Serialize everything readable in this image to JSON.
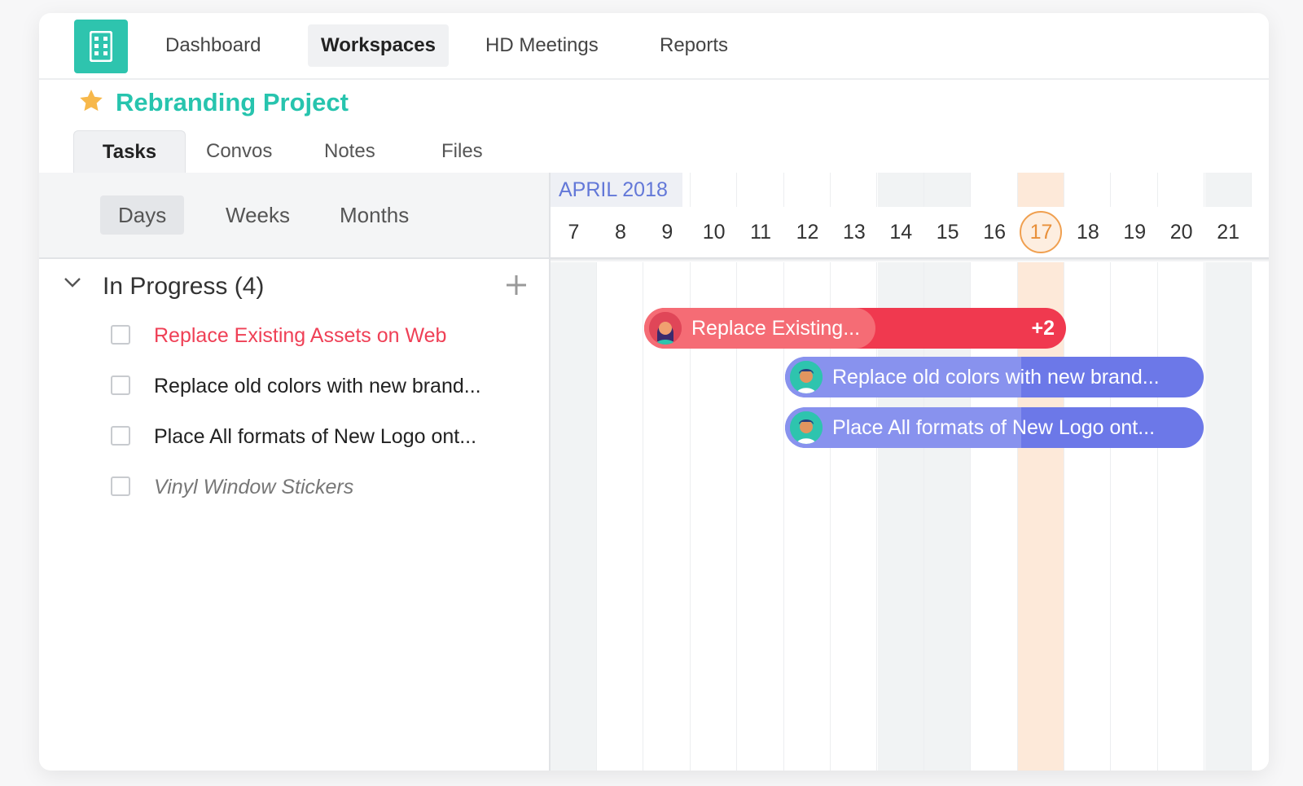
{
  "nav": {
    "items": [
      "Dashboard",
      "Workspaces",
      "HD Meetings",
      "Reports"
    ],
    "active": "Workspaces"
  },
  "project": {
    "title": "Rebranding Project"
  },
  "tabs": [
    "Tasks",
    "Convos",
    "Notes",
    "Files"
  ],
  "view_modes": [
    "Days",
    "Weeks",
    "Months"
  ],
  "group": {
    "title": "In Progress (4)"
  },
  "tasks": [
    {
      "label": "Replace Existing Assets on Web"
    },
    {
      "label": "Replace old colors with new brand..."
    },
    {
      "label": "Place All formats of New Logo ont..."
    },
    {
      "label": "Vinyl Window Stickers"
    }
  ],
  "timeline": {
    "month": "APRIL 2018",
    "days": [
      "7",
      "8",
      "9",
      "10",
      "11",
      "12",
      "13",
      "14",
      "15",
      "16",
      "17",
      "18",
      "19",
      "20",
      "21"
    ],
    "today": "17",
    "bars": [
      {
        "label": "Replace Existing...",
        "extra": "+2",
        "color": "#f0394f"
      },
      {
        "label": "Replace old colors with new brand...",
        "color": "#6c78e8"
      },
      {
        "label": "Place All formats of New Logo ont...",
        "color": "#6c78e8"
      }
    ]
  }
}
